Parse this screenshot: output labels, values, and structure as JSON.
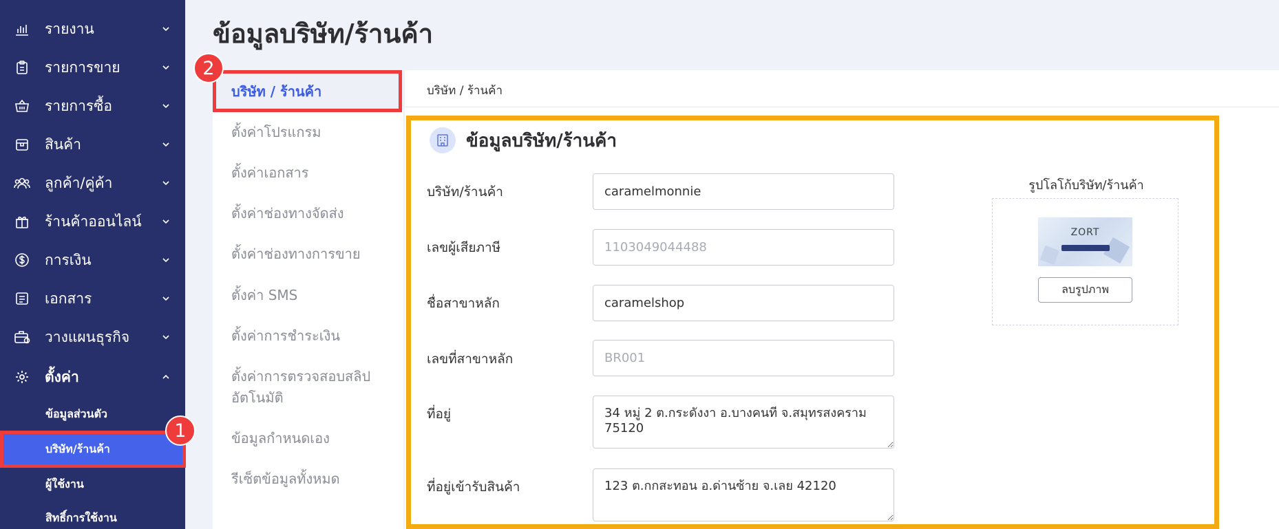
{
  "sidebar": {
    "items": [
      {
        "label": "รายงาน",
        "icon": "bar-chart-icon"
      },
      {
        "label": "รายการขาย",
        "icon": "clipboard-icon"
      },
      {
        "label": "รายการซื้อ",
        "icon": "basket-icon"
      },
      {
        "label": "สินค้า",
        "icon": "box-icon"
      },
      {
        "label": "ลูกค้า/คู่ค้า",
        "icon": "users-icon"
      },
      {
        "label": "ร้านค้าออนไลน์",
        "icon": "gift-icon"
      },
      {
        "label": "การเงิน",
        "icon": "dollar-icon"
      },
      {
        "label": "เอกสาร",
        "icon": "document-icon"
      },
      {
        "label": "วางแผนธุรกิจ",
        "icon": "briefcase-icon"
      },
      {
        "label": "ตั้งค่า",
        "icon": "gear-icon"
      }
    ],
    "sub_items": [
      {
        "label": "ข้อมูลส่วนตัว"
      },
      {
        "label": "บริษัท/ร้านค้า"
      },
      {
        "label": "ผู้ใช้งาน"
      },
      {
        "label": "สิทธิ์การใช้งาน"
      }
    ]
  },
  "annotations": {
    "badge1": "1",
    "badge2": "2"
  },
  "page": {
    "title": "ข้อมูลบริษัท/ร้านค้า"
  },
  "settings_menu": [
    {
      "label": "บริษัท / ร้านค้า"
    },
    {
      "label": "ตั้งค่าโปรแกรม"
    },
    {
      "label": "ตั้งค่าเอกสาร"
    },
    {
      "label": "ตั้งค่าช่องทางจัดส่ง"
    },
    {
      "label": "ตั้งค่าช่องทางการขาย"
    },
    {
      "label": "ตั้งค่า SMS"
    },
    {
      "label": "ตั้งค่าการชำระเงิน"
    },
    {
      "label": "ตั้งค่าการตรวจสอบสลิป"
    },
    {
      "label": "อัตโนมัติ"
    },
    {
      "label": "ข้อมูลกำหนดเอง"
    },
    {
      "label": "รีเซ็ตข้อมูลทั้งหมด"
    }
  ],
  "content": {
    "header": "บริษัท / ร้านค้า",
    "card_title": "ข้อมูลบริษัท/ร้านค้า",
    "fields": {
      "company": {
        "label": "บริษัท/ร้านค้า",
        "value": "caramelmonnie"
      },
      "tax_id": {
        "label": "เลขผู้เสียภาษี",
        "placeholder": "1103049044488"
      },
      "branch_name": {
        "label": "ชื่อสาขาหลัก",
        "value": "caramelshop"
      },
      "branch_no": {
        "label": "เลขที่สาขาหลัก",
        "placeholder": "BR001"
      },
      "address": {
        "label": "ที่อยู่",
        "value": "34 หมู่ 2 ต.กระดังงา อ.บางคนที จ.สมุทรสงคราม 75120"
      },
      "receive_address": {
        "label": "ที่อยู่เข้ารับสินค้า",
        "value": "123 ต.กกสะทอน อ.ด่านซ้าย จ.เลย 42120"
      }
    },
    "logo": {
      "title": "รูปโลโก้บริษัท/ร้านค้า",
      "brand_text": "ZORT",
      "delete_label": "ลบรูปภาพ"
    }
  },
  "colors": {
    "sidebar_bg": "#27306b",
    "active_blue": "#4463ea",
    "highlight_red": "#ee3b3b",
    "highlight_yellow": "#f4aa12"
  }
}
